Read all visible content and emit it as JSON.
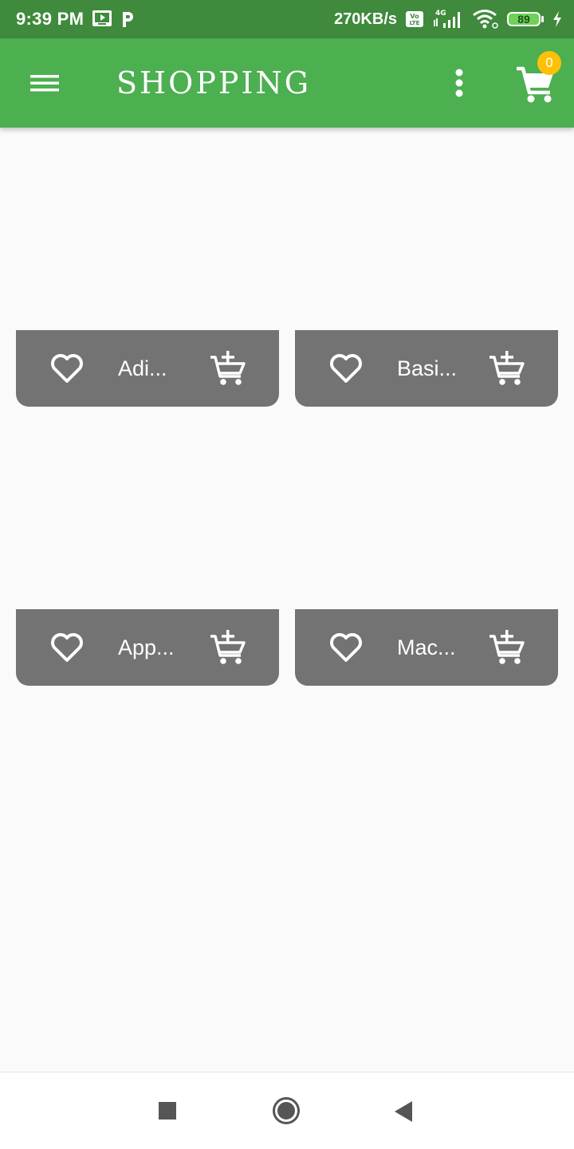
{
  "status_bar": {
    "time": "9:39 PM",
    "network_speed": "270KB/s",
    "network_type": "4G",
    "battery_level": "89",
    "icons": [
      "screen-cast-icon",
      "p-app-icon",
      "volte-icon",
      "signal-icon",
      "wifi-icon",
      "battery-icon",
      "charging-icon"
    ]
  },
  "app_bar": {
    "title": "SHOPPING",
    "cart_count": "0",
    "background": "#4caf50",
    "badge_color": "#ffc107"
  },
  "products": [
    {
      "name": "Adi..."
    },
    {
      "name": "Basi..."
    },
    {
      "name": "App..."
    },
    {
      "name": "Mac..."
    }
  ],
  "colors": {
    "card_footer": "#737373",
    "status_bar": "#3f8a3c",
    "page_background": "#fafafa"
  },
  "nav_bar": {
    "icons": [
      "recent-apps-icon",
      "home-icon",
      "back-icon"
    ]
  }
}
